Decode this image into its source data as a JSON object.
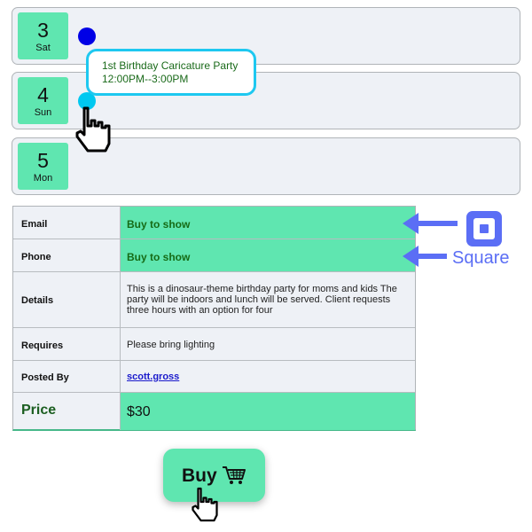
{
  "calendar": {
    "days": [
      {
        "number": "3",
        "weekday": "Sat"
      },
      {
        "number": "4",
        "weekday": "Sun"
      },
      {
        "number": "5",
        "weekday": "Mon"
      }
    ],
    "event": {
      "title": "1st Birthday Caricature Party",
      "time": "12:00PM--3:00PM"
    },
    "colors": {
      "day_badge": "#5fe6b0",
      "dot_event": "#0000e6",
      "dot_hover": "#00c8f0"
    }
  },
  "details": {
    "email": {
      "label": "Email",
      "value": "Buy to show"
    },
    "phone": {
      "label": "Phone",
      "value": "Buy to show"
    },
    "desc": {
      "label": "Details",
      "value": "This is a dinosaur-theme birthday party for moms and kids The party will be indoors and lunch will be served. Client requests three hours with an option for four"
    },
    "requires": {
      "label": "Requires",
      "value": "Please bring lighting"
    },
    "posted": {
      "label": "Posted By",
      "value": "scott.gross"
    },
    "price": {
      "label": "Price",
      "value": "$30"
    }
  },
  "square": {
    "label": "Square",
    "color": "#5b6ef5",
    "icon": "square-logo-icon"
  },
  "buy": {
    "label": "Buy",
    "icon": "shopping-cart-icon"
  },
  "cursors": [
    "hand-pointer-icon",
    "hand-pointer-icon"
  ]
}
